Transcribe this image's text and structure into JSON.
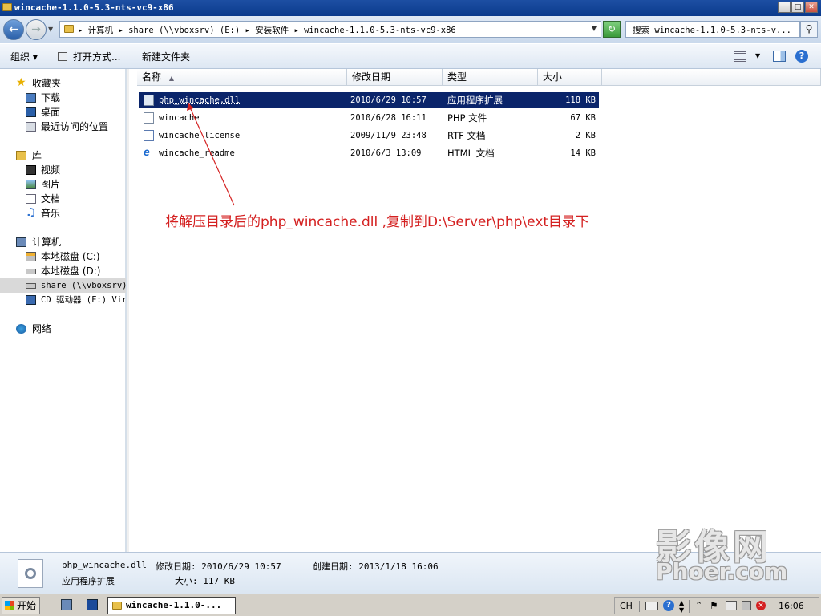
{
  "window": {
    "title": "wincache-1.1.0-5.3-nts-vc9-x86",
    "controls": [
      "_",
      "□",
      "✕"
    ]
  },
  "address": {
    "crumbs": "▸ 计算机 ▸ share (\\\\vboxsrv) (E:) ▸ 安装软件 ▸ wincache-1.1.0-5.3-nts-vc9-x86",
    "search_placeholder": "搜索 wincache-1.1.0-5.3-nts-v..."
  },
  "toolbar": {
    "organize": "组织 ▾",
    "open_with": "打开方式...",
    "new_folder": "新建文件夹"
  },
  "nav": {
    "favorites": "收藏夹",
    "downloads": "下载",
    "desktop": "桌面",
    "recent": "最近访问的位置",
    "libraries": "库",
    "videos": "视频",
    "pictures": "图片",
    "documents": "文档",
    "music": "音乐",
    "computer": "计算机",
    "disk_c": "本地磁盘 (C:)",
    "disk_d": "本地磁盘 (D:)",
    "share": "share (\\\\vboxsrv)",
    "cd": "CD 驱动器 (F:) Vir",
    "network": "网络"
  },
  "columns": {
    "name": "名称",
    "modified": "修改日期",
    "type": "类型",
    "size": "大小"
  },
  "files": [
    {
      "name": "php_wincache.dll",
      "modified": "2010/6/29 10:57",
      "type": "应用程序扩展",
      "size": "118 KB"
    },
    {
      "name": "wincache",
      "modified": "2010/6/28 16:11",
      "type": "PHP 文件",
      "size": "67 KB"
    },
    {
      "name": "wincache_license",
      "modified": "2009/11/9 23:48",
      "type": "RTF 文档",
      "size": "2 KB"
    },
    {
      "name": "wincache_readme",
      "modified": "2010/6/3 13:09",
      "type": "HTML 文档",
      "size": "14 KB"
    }
  ],
  "annotation": "将解压目录后的php_wincache.dll ,复制到D:\\Server\\php\\ext目录下",
  "details": {
    "filename": "php_wincache.dll",
    "modified": "修改日期: 2010/6/29 10:57",
    "created": "创建日期: 2013/1/18 16:06",
    "type": "应用程序扩展",
    "size": "大小: 117 KB"
  },
  "taskbar": {
    "start": "开始",
    "task": "wincache-1.1.0-...",
    "lang": "CH",
    "clock": "16:06"
  },
  "watermark": {
    "line1": "影像网",
    "line2": "Phoer.com"
  },
  "colors": {
    "selection": "#0a246a",
    "annotation": "#d42020"
  }
}
